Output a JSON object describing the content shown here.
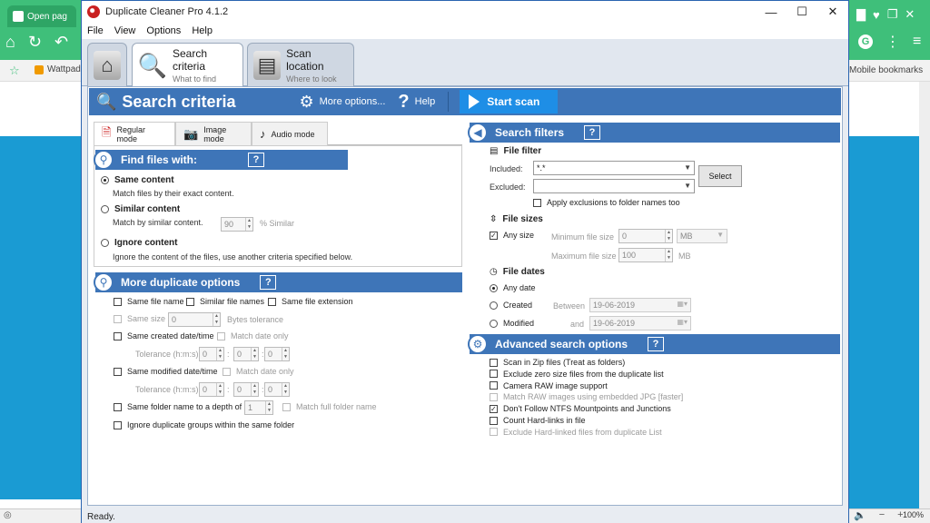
{
  "browser": {
    "tab_label": "Open pag",
    "bookmark_label": "Wattpad",
    "mobile_bookmarks": "Mobile bookmarks",
    "zoom": "100%"
  },
  "window": {
    "title": "Duplicate Cleaner Pro 4.1.2",
    "menu": [
      "File",
      "View",
      "Options",
      "Help"
    ],
    "status": "Ready."
  },
  "tabs": {
    "search": {
      "title": "Search criteria",
      "subtitle": "What to find"
    },
    "scan": {
      "title": "Scan location",
      "subtitle": "Where to look"
    }
  },
  "header": {
    "title": "Search criteria",
    "more_options": "More options...",
    "help": "Help",
    "start_scan": "Start scan"
  },
  "modes": {
    "regular": "Regular mode",
    "image": "Image mode",
    "audio": "Audio mode"
  },
  "find_files": {
    "title": "Find files with:",
    "q": "?",
    "same_content": "Same content",
    "same_content_desc": "Match files by their exact content.",
    "similar_content": "Similar content",
    "similar_content_desc": "Match by similar content.",
    "similar_value": "90",
    "similar_unit": "% Similar",
    "ignore_content": "Ignore content",
    "ignore_content_desc": "Ignore the content of the files, use another criteria specified below."
  },
  "more_dup": {
    "title": "More duplicate options",
    "q": "?",
    "same_file_name": "Same file name",
    "similar_file_names": "Similar file names",
    "same_file_extension": "Same file extension",
    "same_size": "Same size",
    "same_size_value": "0",
    "bytes_tolerance": "Bytes tolerance",
    "same_created": "Same created date/time",
    "match_date_only_1": "Match date only",
    "tolerance_label_1": "Tolerance (h:m:s)",
    "same_modified": "Same modified date/time",
    "match_date_only_2": "Match date only",
    "tolerance_label_2": "Tolerance (h:m:s)",
    "zero": "0",
    "colon": ":",
    "same_folder": "Same folder name to a depth of",
    "depth_value": "1",
    "match_full_folder": "Match full folder name",
    "ignore_groups": "Ignore duplicate groups within the same folder"
  },
  "search_filters": {
    "title": "Search filters",
    "q": "?",
    "file_filter": "File filter",
    "included_label": "Included:",
    "included_value": "*.*",
    "excluded_label": "Excluded:",
    "excluded_value": "",
    "select_button": "Select",
    "apply_exclusions": "Apply exclusions to folder names too",
    "file_sizes": "File sizes",
    "any_size": "Any size",
    "min_size_label": "Minimum file size",
    "min_size_value": "0",
    "min_unit": "MB",
    "max_size_label": "Maximum file size",
    "max_size_value": "100",
    "max_unit": "MB",
    "file_dates": "File dates",
    "any_date": "Any date",
    "created": "Created",
    "between": "Between",
    "date1": "19-06-2019",
    "modified": "Modified",
    "and": "and",
    "date2": "19-06-2019"
  },
  "advanced": {
    "title": "Advanced search options",
    "q": "?",
    "items": [
      {
        "label": "Scan in Zip files (Treat as folders)",
        "checked": false,
        "disabled": false
      },
      {
        "label": "Exclude zero size files from the duplicate list",
        "checked": false,
        "disabled": false
      },
      {
        "label": "Camera RAW image support",
        "checked": false,
        "disabled": false
      },
      {
        "label": "Match RAW images using embedded JPG [faster]",
        "checked": false,
        "disabled": true
      },
      {
        "label": "Don't Follow NTFS Mountpoints and Junctions",
        "checked": true,
        "disabled": false
      },
      {
        "label": "Count Hard-links in file",
        "checked": false,
        "disabled": false
      },
      {
        "label": "Exclude Hard-linked files from duplicate List",
        "checked": false,
        "disabled": true
      }
    ]
  }
}
